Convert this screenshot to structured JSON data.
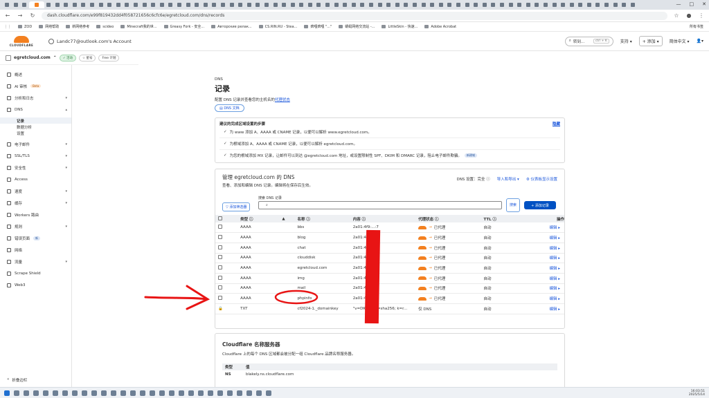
{
  "browser": {
    "url": "dash.cloudflare.com/e99f819432dd4f058721656c6cfc6e/egretcloud.com/dns/records",
    "bookmarks": [
      "ZOD",
      "网络帮助",
      "新网络参考",
      "scideo",
      "Minecraft我的世...",
      "Greasy Fork - 安全...",
      "Авторские релак...",
      "CS.RIN.RU - Stea...",
      "疯哩疯哩 \"...\"",
      "蜻蜓网络交流站 -...",
      "LittleSkin - 快速...",
      "Adobe Acrobat"
    ],
    "bookmarks_right": "所有书签"
  },
  "topbar": {
    "logo_text": "CLOUDFLARE",
    "account": "Landc77@outlook.com's Account",
    "goto": "转到...",
    "goto_kbd": "ctrl + K",
    "support": "支持",
    "add": "+ 添加",
    "language": "简体中文"
  },
  "sidebar": {
    "domain": "egretcloud.com",
    "status": "✓ 活动",
    "star": "☆ 星号",
    "plan": "Free 计划",
    "items": [
      {
        "label": "概述",
        "icon": "overview-icon"
      },
      {
        "label": "AI 审核",
        "icon": "ai-audit-icon",
        "badge": "Beta"
      },
      {
        "label": "分析和日志",
        "icon": "analytics-icon",
        "chev": "▾"
      },
      {
        "label": "DNS",
        "icon": "dns-icon",
        "chev": "▴"
      }
    ],
    "dns_sub": [
      "记录",
      "数据分析",
      "设置"
    ],
    "items2": [
      {
        "label": "电子邮件",
        "icon": "email-icon",
        "chev": "▾"
      },
      {
        "label": "SSL/TLS",
        "icon": "lock-icon",
        "chev": "▾"
      },
      {
        "label": "安全性",
        "icon": "shield-icon",
        "chev": "▾"
      },
      {
        "label": "Access",
        "icon": "access-icon"
      },
      {
        "label": "速度",
        "icon": "speed-icon",
        "chev": "▾"
      },
      {
        "label": "缓存",
        "icon": "cache-icon",
        "chev": "▾"
      },
      {
        "label": "Workers 路由",
        "icon": "workers-icon"
      },
      {
        "label": "规则",
        "icon": "rules-icon",
        "chev": "▾"
      },
      {
        "label": "错误页面",
        "icon": "error-page-icon",
        "badge": "新"
      },
      {
        "label": "网络",
        "icon": "network-icon"
      },
      {
        "label": "流量",
        "icon": "traffic-icon",
        "chev": "▾"
      },
      {
        "label": "Scrape Shield",
        "icon": "scrape-shield-icon"
      },
      {
        "label": "Web3",
        "icon": "web3-icon"
      }
    ],
    "collapse": "折叠边栏"
  },
  "main": {
    "crumb": "DNS",
    "title": "记录",
    "desc_prefix": "配置 DNS 记录并查看您的主机名的",
    "desc_link": "代理状态",
    "doc_btn": "DNS 文档",
    "setup_title": "建议的完成区域设置的步骤",
    "setup_hide": "隐藏",
    "setup_rows": [
      "为 www 添加 A、AAAA 或 CNAME 记录，以便可以解析 www.egretcloud.com。",
      "为根域添加 A、AAAA 或 CNAME 记录，以便可以解析 egretcloud.com。",
      "为您的根域添加 MX 记录，让邮件可以到达 @egretcloud.com 地址，或设置限制性 SPF、DKIM 和 DMARC 记录，阻止电子邮件欺骗。"
    ],
    "setup_new": "新建域",
    "dns_title": "管理 egretcloud.com 的 DNS",
    "dns_sub": "查看、添加和编辑 DNS 记录。编辑将在保存后生效。",
    "dns_setting": "DNS 设置：完全 ⓘ",
    "import_export": "导入和导出 ▾",
    "dashboard_display": "⚙ 仪表板显示设置",
    "filter_btn": "▽ 添加筛选器",
    "search_label": "搜索 DNS 记录",
    "search_btn": "搜索",
    "add_record": "+ 添加记录",
    "columns": [
      "类型 ⓘ",
      "▲",
      "名称 ⓘ",
      "内容 ⓘ",
      "代理状态 ⓘ",
      "TTL ⓘ",
      "操作"
    ],
    "records": [
      {
        "type": "AAAA",
        "name": "bbs",
        "content": "2a01:4f9:...:7",
        "proxy": "已代理",
        "ttl": "自动",
        "edit": "编辑 ▸"
      },
      {
        "type": "AAAA",
        "name": "blog",
        "content": "2a01:4f9:...:7",
        "proxy": "已代理",
        "ttl": "自动",
        "edit": "编辑 ▸"
      },
      {
        "type": "AAAA",
        "name": "chat",
        "content": "2a01:4f9:...:6",
        "proxy": "已代理",
        "ttl": "自动",
        "edit": "编辑 ▸"
      },
      {
        "type": "AAAA",
        "name": "clouddisk",
        "content": "2a01:4f9:...:6",
        "proxy": "已代理",
        "ttl": "自动",
        "edit": "编辑 ▸"
      },
      {
        "type": "AAAA",
        "name": "egretcloud.com",
        "content": "2a01:4f9:...:6",
        "proxy": "已代理",
        "ttl": "自动",
        "edit": "编辑 ▸"
      },
      {
        "type": "AAAA",
        "name": "img",
        "content": "2a01:4f9:...:6",
        "proxy": "已代理",
        "ttl": "自动",
        "edit": "编辑 ▸"
      },
      {
        "type": "AAAA",
        "name": "mail",
        "content": "2a01:4f9:...:7",
        "proxy": "已代理",
        "ttl": "自动",
        "edit": "编辑 ▸"
      },
      {
        "type": "AAAA",
        "name": "phpinfo",
        "content": "2a01:4f9:...:6",
        "proxy": "已代理",
        "ttl": "自动",
        "edit": "编辑 ▸"
      },
      {
        "type": "TXT",
        "name": "cf2024-1._domainkey",
        "content": "\"v=DKIM1; h=sha256; k=r...",
        "proxy": "仅 DNS",
        "ttl": "自动",
        "edit": "编辑 ▸"
      }
    ],
    "ns_title": "Cloudflare 名称服务器",
    "ns_desc": "Cloudflare 上的每个 DNS 区域都会被分配一组 Cloudflare 品牌名称服务器。",
    "ns_head": [
      "类型",
      "值"
    ],
    "ns_rows": [
      {
        "type": "NS",
        "value": "blakely.ns.cloudflare.com"
      }
    ]
  },
  "taskbar": {
    "time": "16:03:51",
    "date": "2025/5/14"
  },
  "colors": {
    "accent": "#0051c3",
    "cloudflare_orange": "#f38020",
    "annotation_red": "#e81414"
  }
}
